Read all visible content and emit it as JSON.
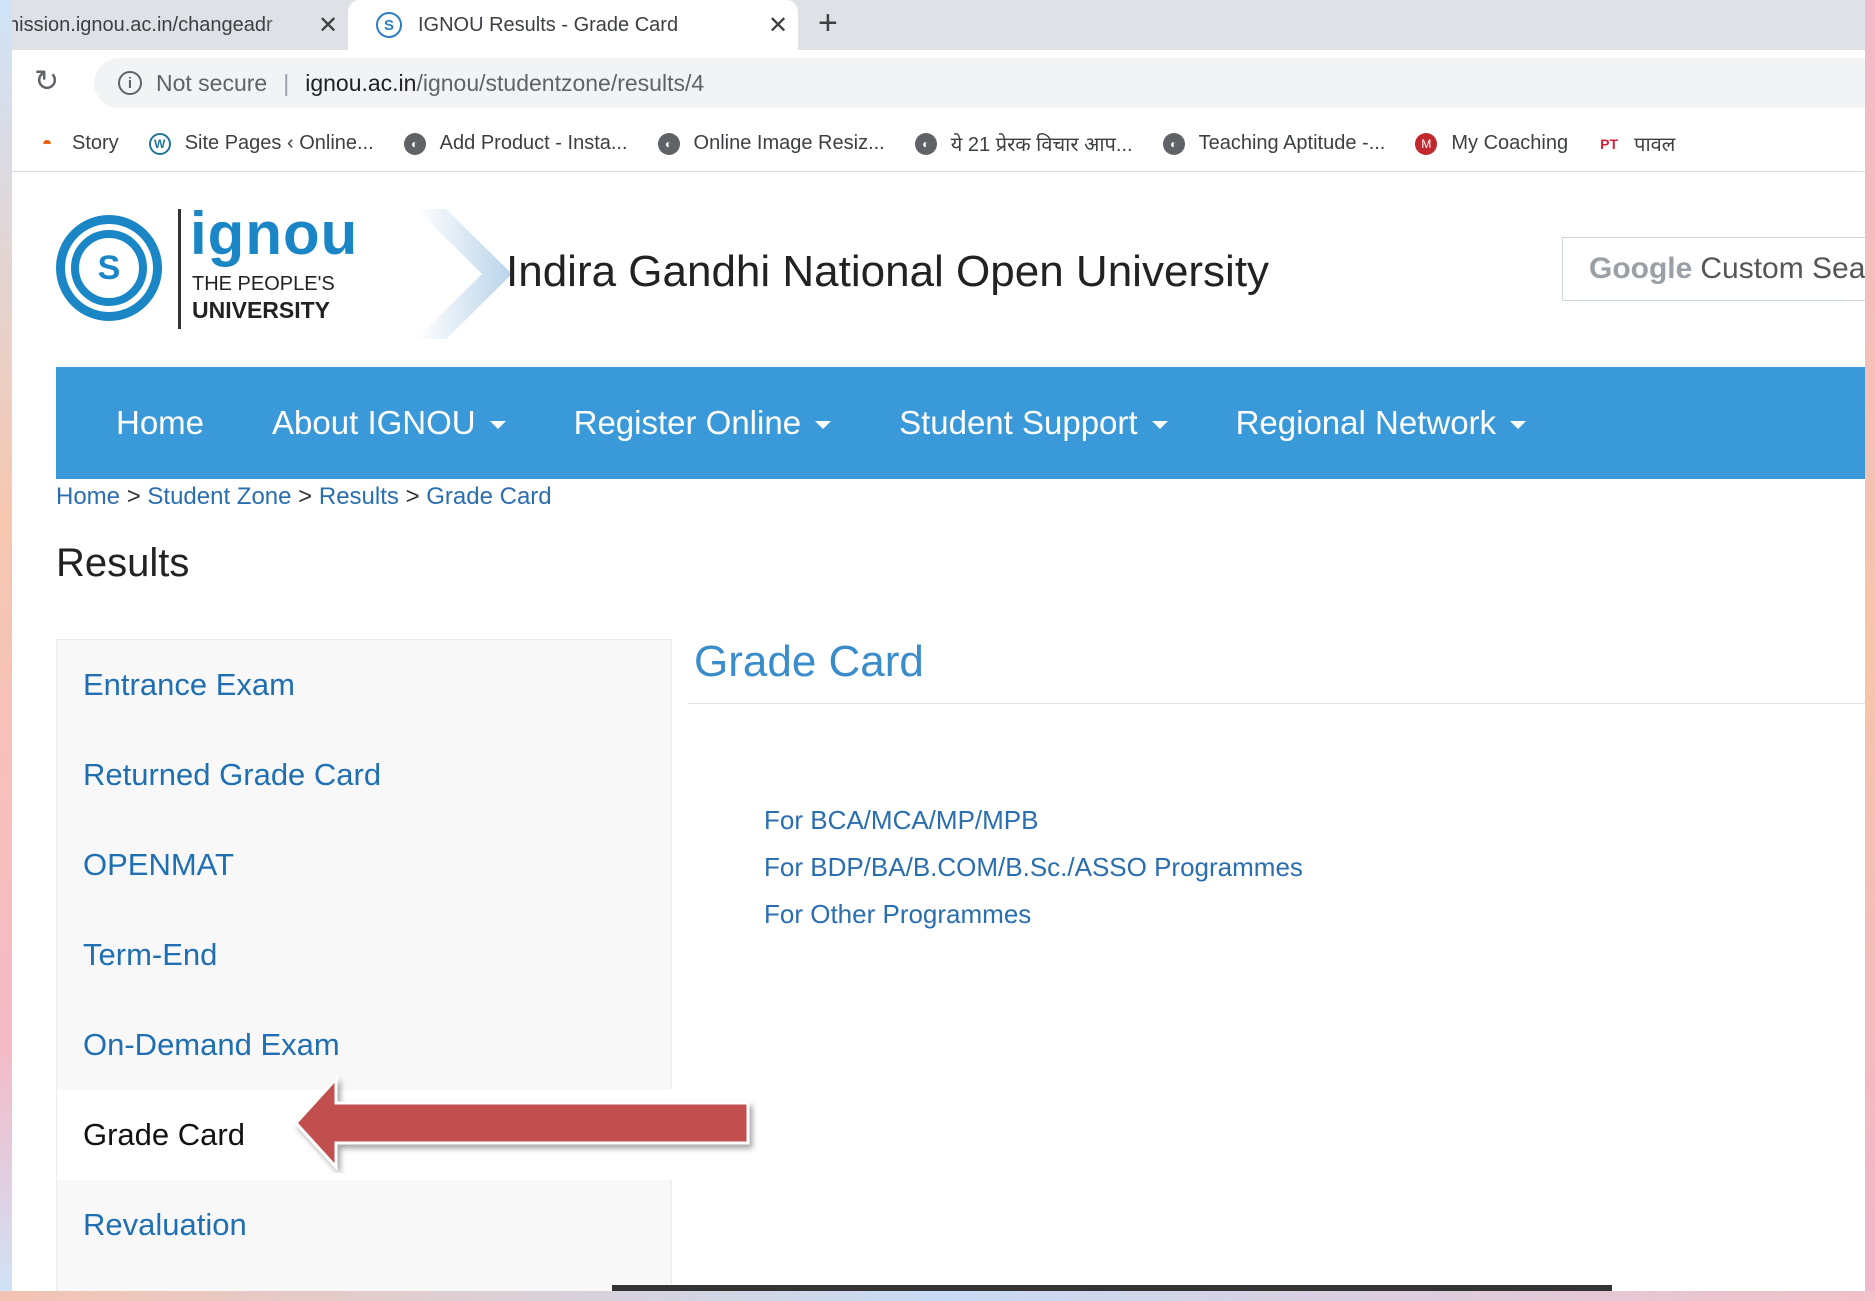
{
  "browser": {
    "tabs": [
      {
        "title": "hission.ignou.ac.in/changeadr",
        "active": false
      },
      {
        "title": "IGNOU Results - Grade Card",
        "active": true
      }
    ],
    "new_tab_icon": "plus-icon",
    "security_label": "Not secure",
    "url_host": "ignou.ac.in",
    "url_path": "/ignou/studentzone/results/4",
    "bookmarks": [
      {
        "label": "Story",
        "icon": "story-icon"
      },
      {
        "label": "Site Pages ‹ Online...",
        "icon": "wordpress-icon"
      },
      {
        "label": "Add Product - Insta...",
        "icon": "globe-icon"
      },
      {
        "label": "Online Image Resiz...",
        "icon": "globe-icon"
      },
      {
        "label": "ये 21 प्रेरक विचार आप...",
        "icon": "globe-icon"
      },
      {
        "label": "Teaching Aptitude -...",
        "icon": "globe-icon"
      },
      {
        "label": "My Coaching",
        "icon": "my-coaching-icon"
      },
      {
        "label": "पावल",
        "icon": "pt-icon"
      }
    ]
  },
  "header": {
    "logo_word": "ignou",
    "logo_line1": "THE PEOPLE'S",
    "logo_line2": "UNIVERSITY",
    "site_title": "Indira Gandhi National Open University",
    "search_google": "Google",
    "search_placeholder": "Custom Sea"
  },
  "nav": {
    "items": [
      {
        "label": "Home",
        "dropdown": false
      },
      {
        "label": "About IGNOU",
        "dropdown": true
      },
      {
        "label": "Register Online",
        "dropdown": true
      },
      {
        "label": "Student Support",
        "dropdown": true
      },
      {
        "label": "Regional Network",
        "dropdown": true
      }
    ]
  },
  "breadcrumb": {
    "items": [
      "Home",
      "Student Zone",
      "Results",
      "Grade Card"
    ],
    "separator": ">"
  },
  "page_title": "Results",
  "sidebar": {
    "items": [
      {
        "label": "Entrance Exam",
        "active": false
      },
      {
        "label": "Returned Grade Card",
        "active": false
      },
      {
        "label": "OPENMAT",
        "active": false
      },
      {
        "label": "Term-End",
        "active": false
      },
      {
        "label": "On-Demand Exam",
        "active": false
      },
      {
        "label": "Grade Card",
        "active": true
      },
      {
        "label": "Revaluation",
        "active": false
      }
    ]
  },
  "content": {
    "title": "Grade Card",
    "links": [
      "For BCA/MCA/MP/MPB",
      "For BDP/BA/B.COM/B.Sc./ASSO Programmes",
      "For Other Programmes"
    ]
  },
  "annotation": {
    "arrow_color": "#c0504d",
    "arrow_icon": "left-arrow-icon"
  },
  "colors": {
    "nav_bg": "#3a99d8",
    "link": "#2a6eb0",
    "brand_blue": "#1b86c6"
  }
}
